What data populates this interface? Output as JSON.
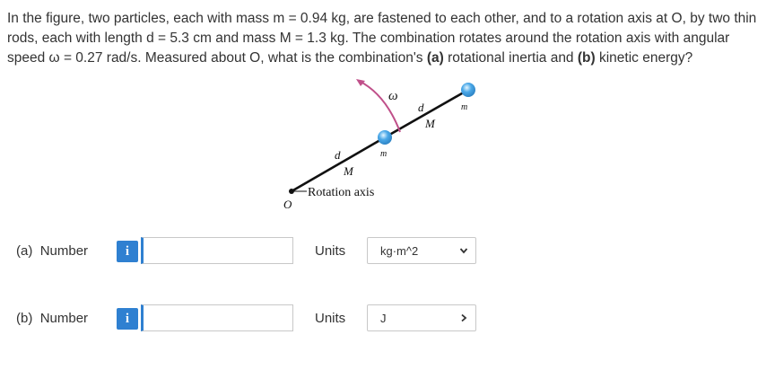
{
  "question": {
    "text": "In the figure, two particles, each with mass m = 0.94 kg, are fastened to each other, and to a rotation axis at O, by two thin rods, each with length d = 5.3 cm and mass M = 1.3 kg. The combination rotates around the rotation axis with angular speed ω = 0.27 rad/s. Measured about O, what is the combination's ",
    "part_a_marker": "(a)",
    "middle": " rotational inertia and ",
    "part_b_marker": "(b)",
    "end": " kinetic energy?"
  },
  "figure": {
    "label_omega": "ω",
    "label_d_upper": "d",
    "label_M_upper": "M",
    "label_m_upper": "m",
    "label_m_lower": "m",
    "label_d_lower": "d",
    "label_M_lower": "M",
    "label_rotation_axis": "Rotation axis",
    "label_origin": "O",
    "colors": {
      "particle": "#4aa8e8",
      "arrow": "#c0508a",
      "rod": "#111111"
    }
  },
  "answers": [
    {
      "label": "(a)",
      "number_label": "Number",
      "info_icon": "i",
      "value": "",
      "units_label": "Units",
      "units_value": "kg·m^2",
      "dropdown": "chevron-down"
    },
    {
      "label": "(b)",
      "number_label": "Number",
      "info_icon": "i",
      "value": "",
      "units_label": "Units",
      "units_value": "J",
      "dropdown": "chevron-right"
    }
  ],
  "accent_color": "#2f80d1"
}
